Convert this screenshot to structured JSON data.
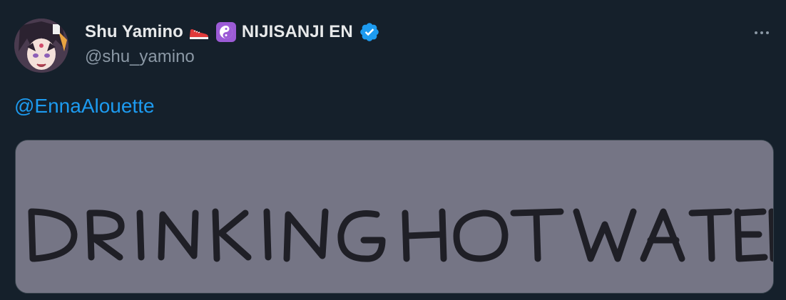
{
  "tweet": {
    "author": {
      "display_name": "Shu Yamino",
      "affiliation": "NIJISANJI EN",
      "handle": "@shu_yamino",
      "avatar_icon": "avatar-image",
      "emoji_1": "sneaker-emoji",
      "emoji_2": "yin-yang-emoji",
      "verified_icon": "verified-badge-icon"
    },
    "menu_icon": "more-options-icon",
    "text": {
      "mention": "@EnnaAlouette"
    },
    "media": {
      "image_text": "DRINKING HOT WATER"
    }
  },
  "colors": {
    "background": "#15202b",
    "primary_text": "#e7e9ea",
    "secondary_text": "#8b98a5",
    "link": "#1d9bf0",
    "verified": "#1d9bf0",
    "media_bg": "#757585",
    "handwriting": "#1f1f26"
  }
}
